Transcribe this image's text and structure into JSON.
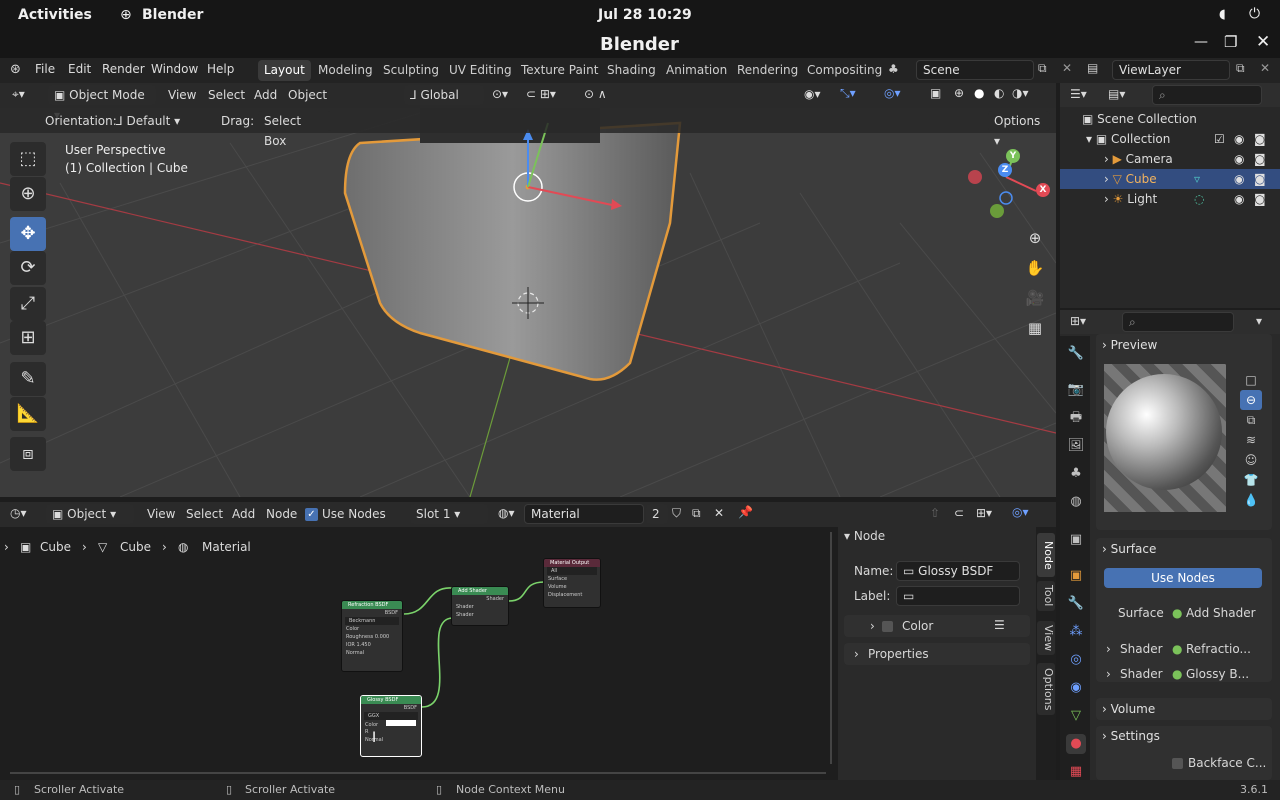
{
  "system": {
    "activities": "Activities",
    "app": "Blender",
    "clock": "Jul 28  10:29"
  },
  "window": {
    "title": "Blender"
  },
  "menu": {
    "file": "File",
    "edit": "Edit",
    "render": "Render",
    "window": "Window",
    "help": "Help"
  },
  "workspaces": [
    "Layout",
    "Modeling",
    "Sculpting",
    "UV Editing",
    "Texture Paint",
    "Shading",
    "Animation",
    "Rendering",
    "Compositing"
  ],
  "scene": {
    "name": "Scene",
    "view_layer": "ViewLayer"
  },
  "viewport": {
    "mode": "Object Mode",
    "view": "View",
    "select": "Select",
    "add": "Add",
    "object": "Object",
    "transform": "Global",
    "orientation_label": "Orientation:",
    "orientation": "Default",
    "drag_label": "Drag:",
    "drag": "Select Box",
    "options": "Options",
    "info_line1": "User Perspective",
    "info_line2": "(1) Collection | Cube",
    "gizmo": {
      "x": "X",
      "y": "Y",
      "z": "Z"
    }
  },
  "outliner": {
    "root": "Scene Collection",
    "collection": "Collection",
    "items": [
      {
        "name": "Camera",
        "selected": false
      },
      {
        "name": "Cube",
        "selected": true
      },
      {
        "name": "Light",
        "selected": false
      }
    ]
  },
  "properties": {
    "preview": "Preview",
    "surface_panel": "Surface",
    "use_nodes": "Use Nodes",
    "surface_label": "Surface",
    "surface_value": "Add Shader",
    "shader_label": "Shader",
    "shader1": "Refractio...",
    "shader2": "Glossy B...",
    "volume": "Volume",
    "settings": "Settings",
    "backface": "Backface C..."
  },
  "node_editor": {
    "editor_type": "Object",
    "view": "View",
    "select": "Select",
    "add": "Add",
    "node": "Node",
    "use_nodes": "Use Nodes",
    "slot": "Slot 1",
    "material": "Material",
    "users": "2",
    "breadcrumb": [
      "Cube",
      "Cube",
      "Material"
    ],
    "nodes": {
      "refraction": {
        "title": "Refraction BSDF",
        "out": "BSDF",
        "dist": "Beckmann",
        "color": "Color",
        "roughness": "Roughness",
        "roughness_val": "0.000",
        "ior": "IOR",
        "ior_val": "1.450",
        "normal": "Normal"
      },
      "add": {
        "title": "Add Shader",
        "out": "Shader",
        "in1": "Shader",
        "in2": "Shader"
      },
      "output": {
        "title": "Material Output",
        "target": "All",
        "surface": "Surface",
        "volume": "Volume",
        "displacement": "Displacement"
      },
      "glossy": {
        "title": "Glossy BSDF",
        "out": "BSDF",
        "dist": "GGX",
        "color": "Color",
        "roughness": "R",
        "normal": "Normal"
      }
    }
  },
  "sidebar": {
    "panel": "Node",
    "name_label": "Name:",
    "name_value": "Glossy BSDF",
    "label_label": "Label:",
    "color": "Color",
    "properties": "Properties",
    "tabs": [
      "Node",
      "Tool",
      "View",
      "Options"
    ]
  },
  "status": {
    "s1": "Scroller Activate",
    "s2": "Scroller Activate",
    "s3": "Node Context Menu",
    "version": "3.6.1"
  },
  "colors": {
    "accent": "#4772b3",
    "selection": "#e39a3b",
    "node_header_shader": "#3a8b53",
    "link": "#7bd36b"
  }
}
